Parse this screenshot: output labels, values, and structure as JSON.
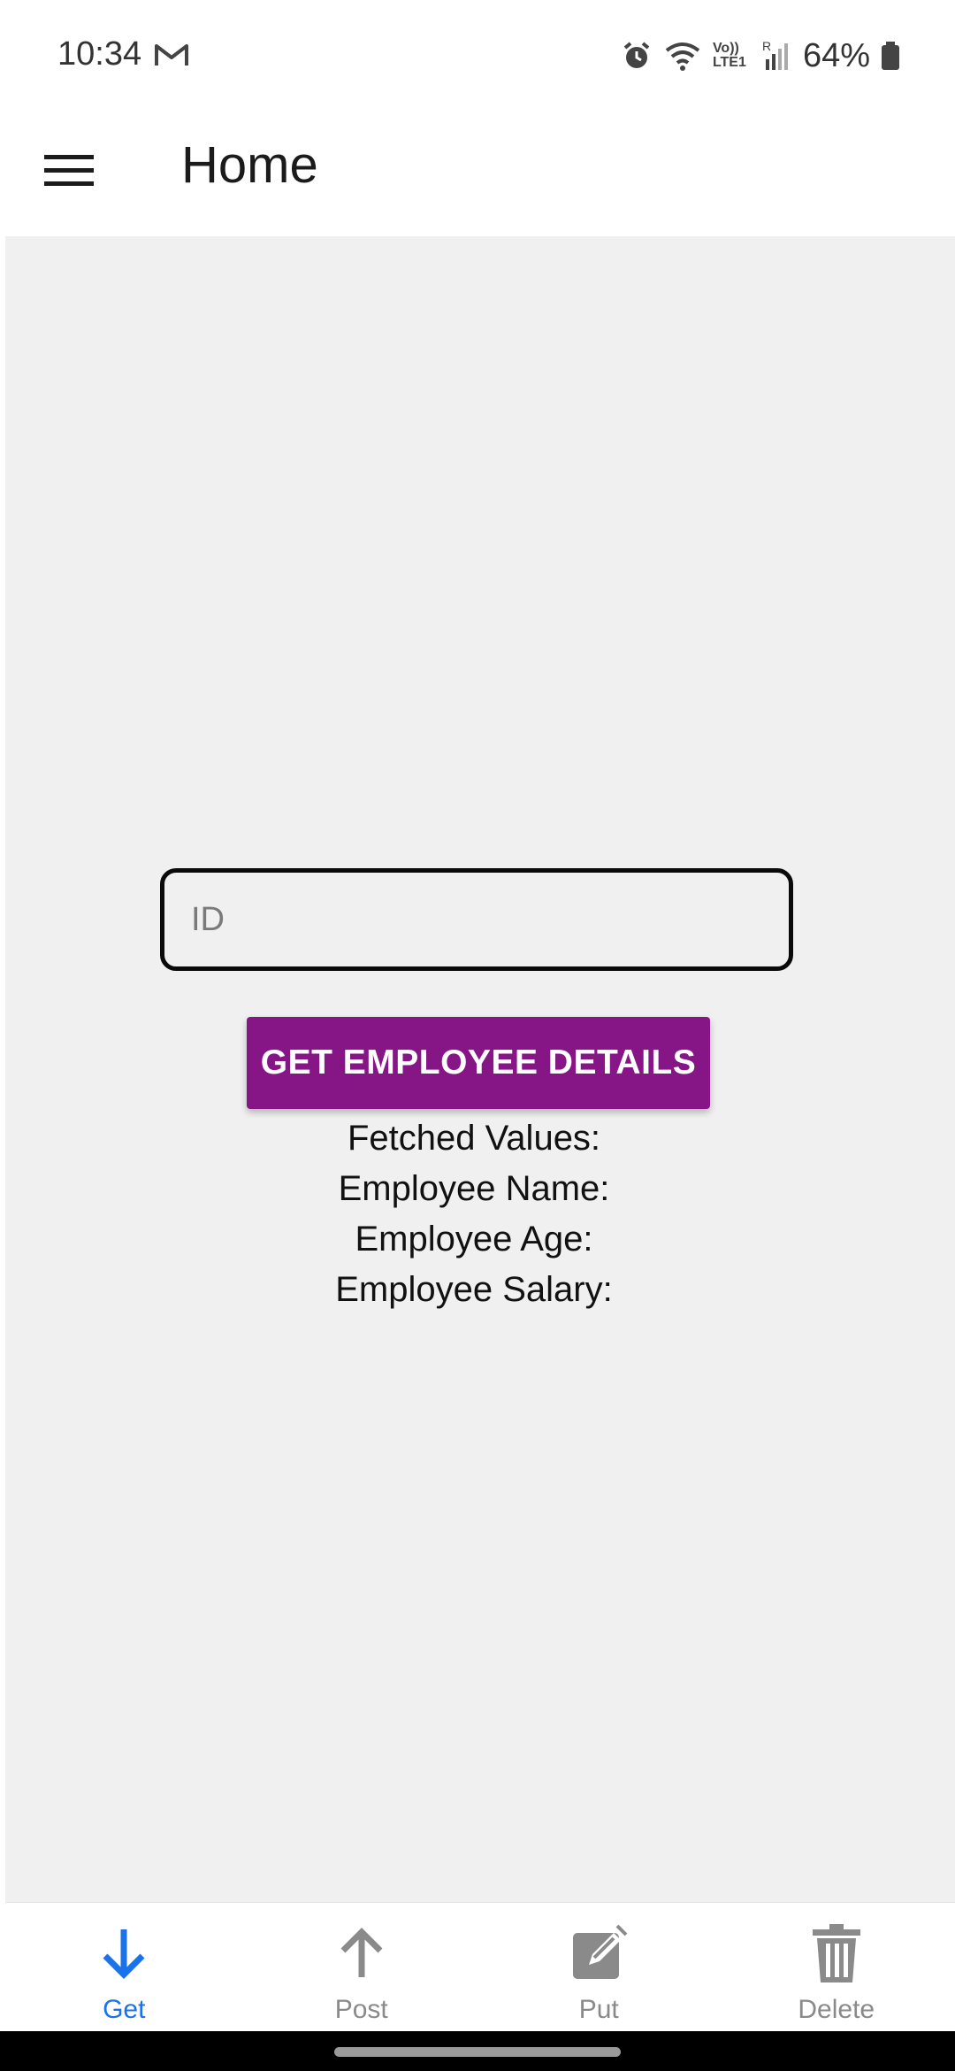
{
  "status_bar": {
    "time": "10:34",
    "battery_percent": "64%",
    "network_label": "Vo)) LTE1",
    "roaming": "R"
  },
  "app_bar": {
    "title": "Home"
  },
  "form": {
    "id_placeholder": "ID",
    "id_value": "",
    "button_label": "GET EMPLOYEE DETAILS"
  },
  "results": {
    "fetched_values": "Fetched Values:",
    "employee_name": "Employee Name:",
    "employee_age": "Employee Age:",
    "employee_salary": "Employee Salary:"
  },
  "bottom_nav": {
    "items": [
      {
        "label": "Get",
        "icon": "arrow-down-icon",
        "active": true
      },
      {
        "label": "Post",
        "icon": "arrow-up-icon",
        "active": false
      },
      {
        "label": "Put",
        "icon": "edit-icon",
        "active": false
      },
      {
        "label": "Delete",
        "icon": "trash-icon",
        "active": false
      }
    ]
  },
  "colors": {
    "accent": "#861686",
    "active_nav": "#1a73e8",
    "inactive_nav": "#8a8a8a",
    "content_bg": "#f0f0f0"
  }
}
